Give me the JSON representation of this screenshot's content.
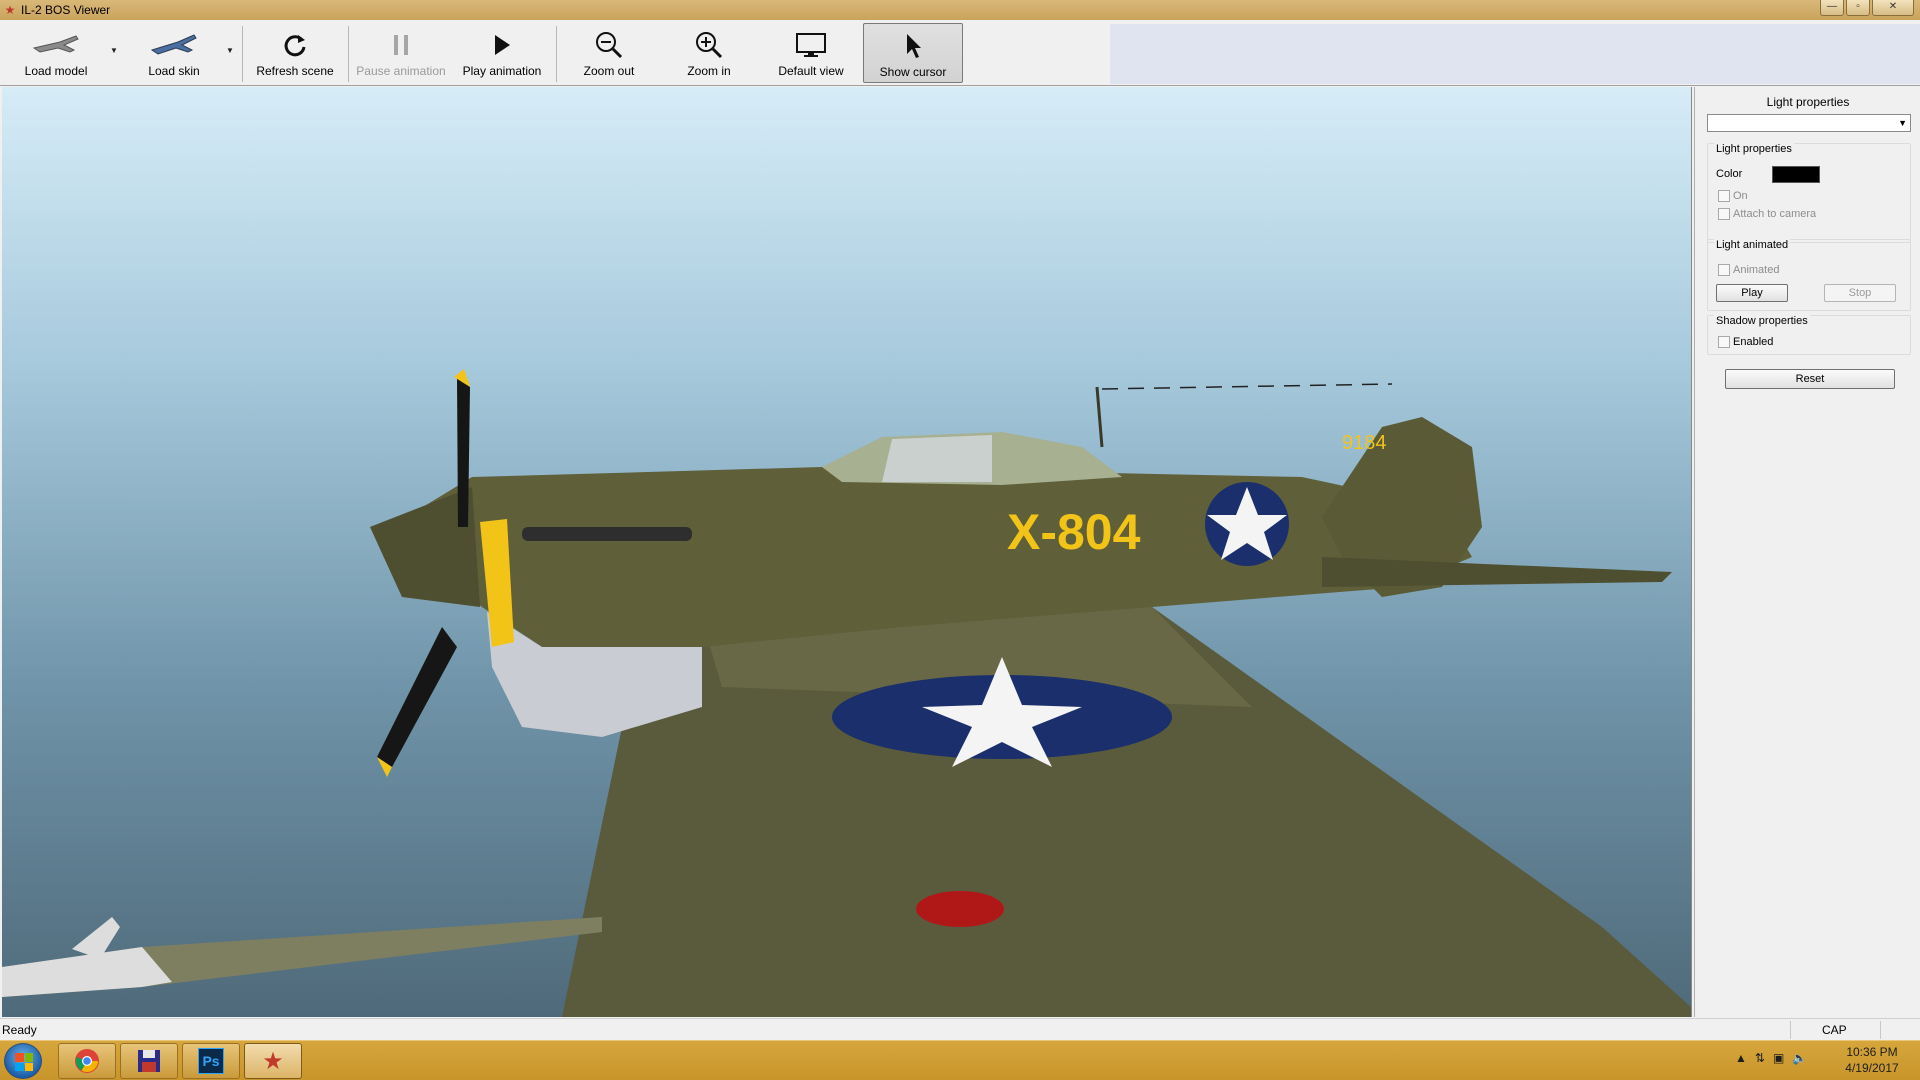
{
  "window": {
    "title": "IL-2 BOS Viewer"
  },
  "toolbar": {
    "load_model": "Load model",
    "load_skin": "Load skin",
    "refresh_scene": "Refresh scene",
    "pause_animation": "Pause animation",
    "play_animation": "Play animation",
    "zoom_out": "Zoom out",
    "zoom_in": "Zoom in",
    "default_view": "Default view",
    "show_cursor": "Show cursor"
  },
  "viewport": {
    "fuselage_code": "X-804",
    "tail_number": "9184"
  },
  "panel": {
    "header": "Light properties",
    "light_group": {
      "title": "Light properties",
      "color_label": "Color",
      "color_value": "#000000",
      "on_label": "On",
      "attach_label": "Attach to camera"
    },
    "animated_group": {
      "title": "Light animated",
      "animated_label": "Animated",
      "play_label": "Play",
      "stop_label": "Stop"
    },
    "shadow_group": {
      "title": "Shadow properties",
      "enabled_label": "Enabled"
    },
    "reset_label": "Reset"
  },
  "statusbar": {
    "text": "Ready",
    "cap": "CAP"
  },
  "taskbar": {
    "time": "10:36 PM",
    "date": "4/19/2017",
    "apps": [
      "chrome-icon",
      "save-disk-icon",
      "photoshop-icon",
      "il2-star-icon"
    ],
    "photoshop_label": "Ps"
  },
  "colors": {
    "taskbar": "#c8952a",
    "aircraft_olive": "#5f5f3a",
    "roundel_blue": "#1a2f6b",
    "code_yellow": "#f2c418"
  }
}
